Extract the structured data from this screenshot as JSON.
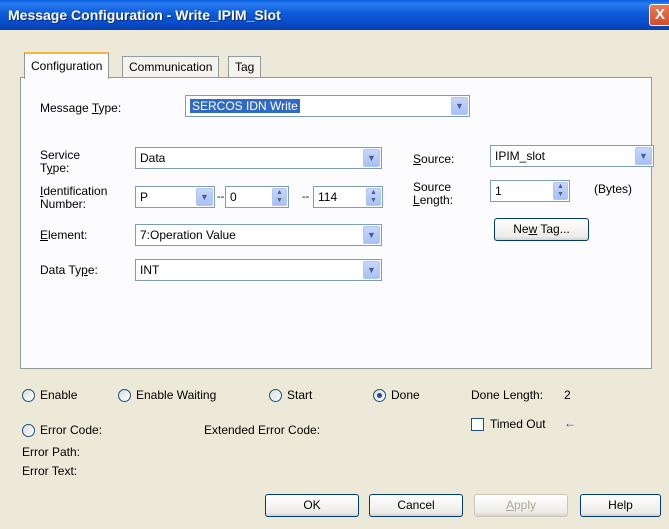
{
  "window": {
    "title": "Message Configuration - Write_IPIM_Slot",
    "close_glyph": "X"
  },
  "tabs": [
    {
      "label": "Configuration",
      "active": true
    },
    {
      "label": "Communication",
      "active": false
    },
    {
      "label": "Tag",
      "active": false
    }
  ],
  "config": {
    "message_type": {
      "label_pre": "Message ",
      "label_key": "T",
      "label_post": "ype:",
      "value": "SERCOS IDN Write"
    },
    "service_type": {
      "label_line1": "Service",
      "label_key": "y",
      "label_line2_pre": "T",
      "label_line2_post": "pe:",
      "value": "Data"
    },
    "identification": {
      "label_key": "I",
      "label_line1_post": "dentification",
      "label_line2": "Number:",
      "part1": "P",
      "separator1": "--",
      "part2": "0",
      "separator2": "--",
      "part3": "114"
    },
    "element": {
      "label_key": "E",
      "label_post": "lement:",
      "value": "7:Operation Value"
    },
    "data_type": {
      "label_pre": "Data Ty",
      "label_key": "p",
      "label_post": "e:",
      "value": "INT"
    },
    "source": {
      "label_key": "S",
      "label_post": "ource:",
      "value": "IPIM_slot"
    },
    "source_length": {
      "label_line1": "Source",
      "label_key": "L",
      "label_line2_post": "ength:",
      "value": "1",
      "unit": "(Bytes)"
    },
    "new_tag_button": {
      "pre": "Ne",
      "key": "w",
      "post": " Tag..."
    }
  },
  "status": {
    "enable": "Enable",
    "enable_waiting": "Enable Waiting",
    "start": "Start",
    "done": "Done",
    "done_length_label": "Done Length:",
    "done_length_value": "2",
    "error_code": "Error Code:",
    "extended_error_code": "Extended Error Code:",
    "timed_out": "Timed Out",
    "error_path": "Error Path:",
    "error_text": "Error Text:"
  },
  "buttons": {
    "ok": "OK",
    "cancel": "Cancel",
    "apply_key": "A",
    "apply_post": "pply",
    "help": "Help"
  },
  "icons": {
    "dropdown_arrow": "▼",
    "spin_up": "▲",
    "spin_down": "▼",
    "timed_out_arrow": "←"
  },
  "colors": {
    "titlebar": "#0a5fde",
    "selection": "#316ac5",
    "active_tab_accent": "#f6b741"
  }
}
